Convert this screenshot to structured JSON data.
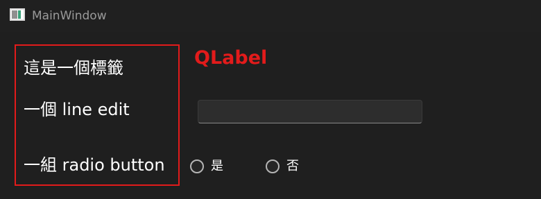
{
  "window": {
    "title": "MainWindow",
    "icon": "app-window-icon"
  },
  "labels": {
    "label_text": "這是一個標籤",
    "line_edit_text": "一個 line edit",
    "radio_button_text": "一組 radio button",
    "qlabel_annotation": "QLabel"
  },
  "line_edit": {
    "value": "",
    "placeholder": ""
  },
  "radio_buttons": [
    {
      "label": "是",
      "checked": false
    },
    {
      "label": "否",
      "checked": false
    }
  ],
  "colors": {
    "background": "#1f1f1f",
    "annotation_red": "#e21b1b",
    "text": "#ffffff"
  }
}
